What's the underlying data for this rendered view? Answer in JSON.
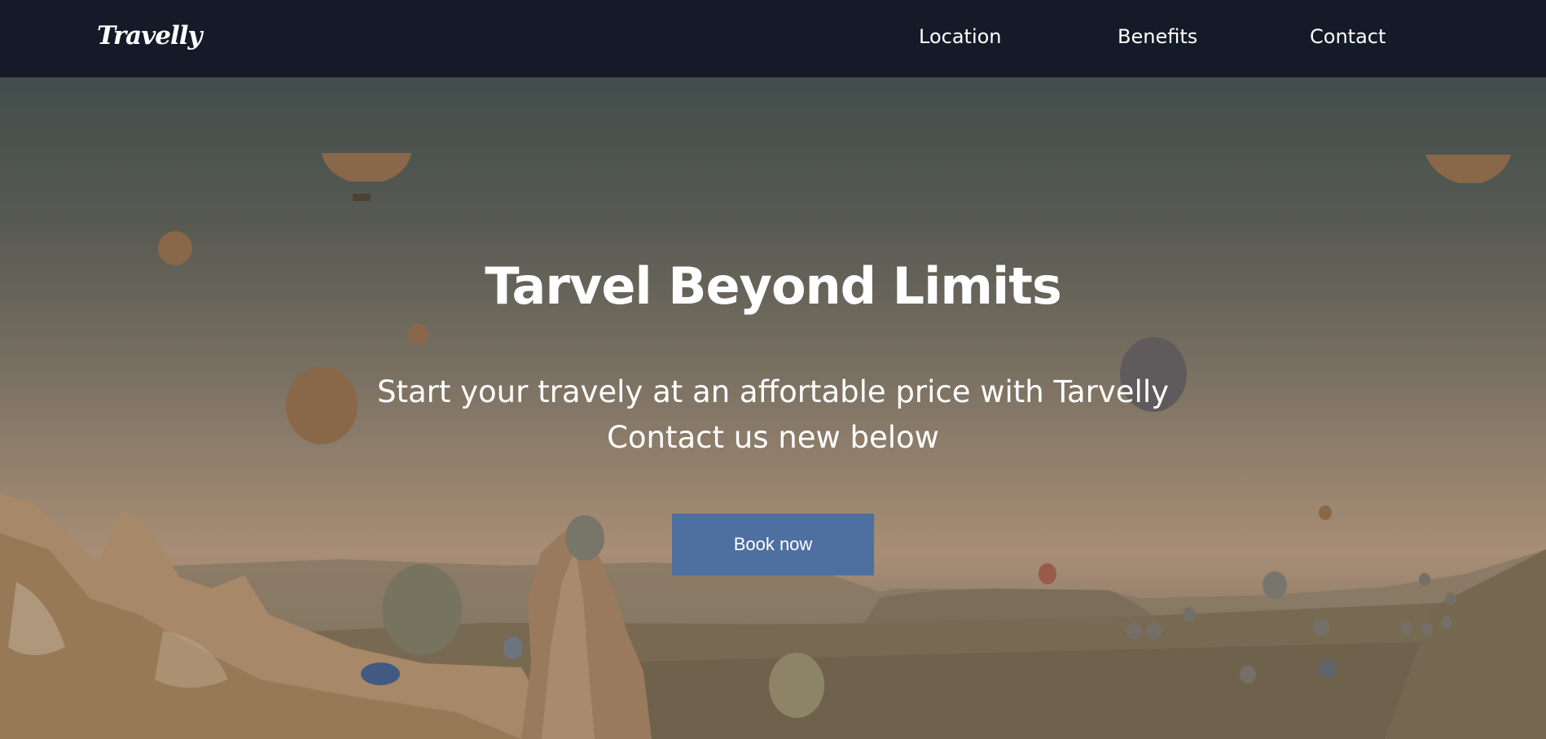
{
  "nav": {
    "logo": "Travelly",
    "links": [
      "Location",
      "Benefits",
      "Contact"
    ]
  },
  "hero": {
    "title": "Tarvel Beyond Limits",
    "subtitle_line1": "Start your travely at an affortable price with Tarvelly",
    "subtitle_line2": "Contact us new below",
    "button_label": "Book now"
  },
  "colors": {
    "navbar_bg": "#141a28",
    "button_bg": "#4d70a0",
    "text": "#ffffff"
  }
}
